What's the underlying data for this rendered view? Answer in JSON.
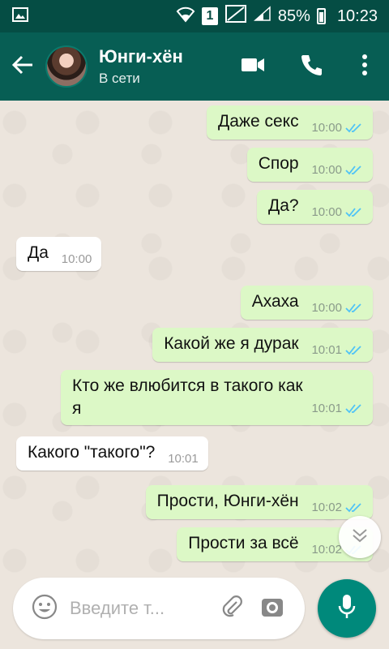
{
  "status_bar": {
    "sim_badge": "1",
    "battery_percent": "85%",
    "time": "10:23",
    "icons": [
      "gallery-icon",
      "wifi-icon",
      "no-signal-icon",
      "signal-icon",
      "battery-icon"
    ]
  },
  "header": {
    "contact_name": "Юнги-хён",
    "contact_status": "В сети",
    "icons": [
      "back-arrow-icon",
      "video-call-icon",
      "phone-call-icon",
      "more-vert-icon"
    ]
  },
  "messages": [
    {
      "direction": "out",
      "text": "Даже секс",
      "time": "10:00",
      "ticks": "read"
    },
    {
      "direction": "out",
      "text": "Спор",
      "time": "10:00",
      "ticks": "read"
    },
    {
      "direction": "out",
      "text": "Да?",
      "time": "10:00",
      "ticks": "read"
    },
    {
      "direction": "in",
      "text": "Да",
      "time": "10:00"
    },
    {
      "direction": "out",
      "text": "Ахаха",
      "time": "10:00",
      "ticks": "read"
    },
    {
      "direction": "out",
      "text": "Какой же я дурак",
      "time": "10:01",
      "ticks": "read"
    },
    {
      "direction": "out",
      "text": "Кто же влюбится в такого как я",
      "time": "10:01",
      "ticks": "read"
    },
    {
      "direction": "in",
      "text": "Какого \"такого\"?",
      "time": "10:01"
    },
    {
      "direction": "out",
      "text": "Прости, Юнги-хён",
      "time": "10:02",
      "ticks": "read"
    },
    {
      "direction": "out",
      "text": "Прости за всё",
      "time": "10:02",
      "ticks": "read"
    }
  ],
  "composer": {
    "placeholder": "Введите т...",
    "icons": [
      "emoji-icon",
      "attach-icon",
      "camera-icon",
      "mic-icon",
      "scroll-down-icon"
    ]
  },
  "colors": {
    "status_bar": "#054d44",
    "app_bar": "#075e54",
    "outgoing_bubble": "#dcf8c6",
    "incoming_bubble": "#ffffff",
    "read_tick": "#4fc3f7",
    "mic_button": "#00897b",
    "chat_background": "#ece5dd"
  }
}
